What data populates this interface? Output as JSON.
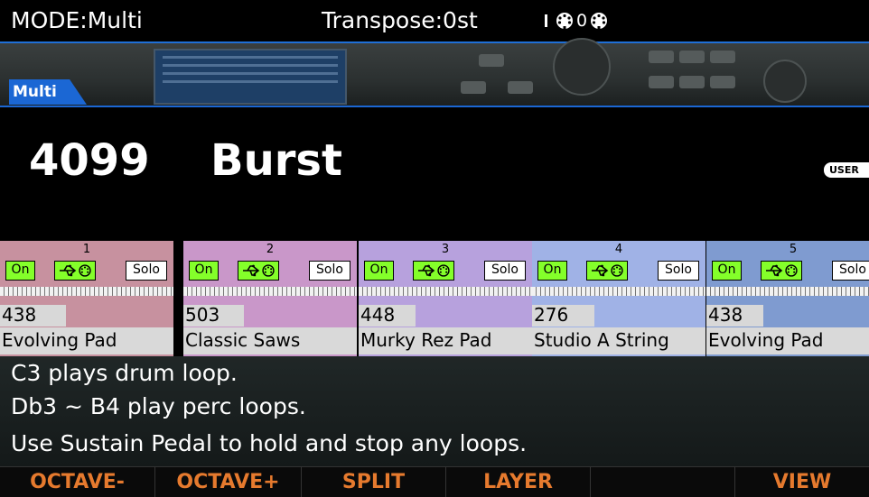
{
  "status_bar": {
    "mode": "MODE:Multi",
    "transpose": "Transpose:0st",
    "midi_count": "0",
    "icons": [
      "midi-din-icon",
      "midi-din-icon"
    ]
  },
  "tab": {
    "label": "Multi"
  },
  "program": {
    "number": "4099",
    "name": "Burst",
    "badge": "USER"
  },
  "zones": [
    {
      "number": "1",
      "on_label": "On",
      "solo_label": "Solo",
      "program_number": "438",
      "program_name": "Evolving Pad",
      "color": "#c7919f",
      "range_fraction": 0.38
    },
    {
      "number": "2",
      "on_label": "On",
      "solo_label": "Solo",
      "program_number": "503",
      "program_name": "Classic Saws",
      "color": "#c997c9",
      "range_fraction": 0.35
    },
    {
      "number": "3",
      "on_label": "On",
      "solo_label": "Solo",
      "program_number": "448",
      "program_name": "Murky Rez Pad",
      "color": "#b7a1dd",
      "range_fraction": 0.33
    },
    {
      "number": "4",
      "on_label": "On",
      "solo_label": "Solo",
      "program_number": "276",
      "program_name": "Studio A String",
      "color": "#a0b2e6",
      "range_fraction": 0.36
    },
    {
      "number": "5",
      "on_label": "On",
      "solo_label": "Solo",
      "program_number": "438",
      "program_name": "Evolving Pad",
      "color": "#7f9bd0",
      "range_fraction": 0.33
    }
  ],
  "info": {
    "lines": [
      "C3 plays drum loop.",
      "Db3 ~ B4 play perc loops.",
      "Use Sustain Pedal to hold and stop any loops."
    ]
  },
  "soft_buttons": [
    "OCTAVE-",
    "OCTAVE+",
    "SPLIT",
    "LAYER",
    "",
    "VIEW"
  ],
  "colors": {
    "accent_blue": "#1b67d4",
    "soft_button_text": "#e67a2e",
    "toggle_green": "#84ff2a"
  }
}
